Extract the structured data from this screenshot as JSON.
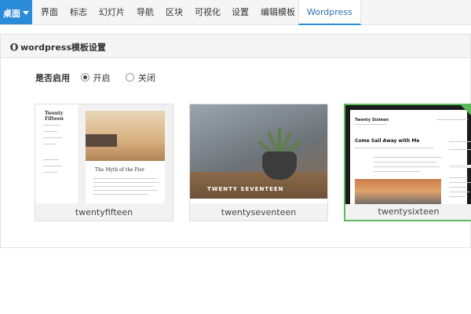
{
  "nav": {
    "desktop_label": "桌面",
    "items": [
      {
        "label": "界面"
      },
      {
        "label": "标志"
      },
      {
        "label": "幻灯片"
      },
      {
        "label": "导航"
      },
      {
        "label": "区块"
      },
      {
        "label": "可视化"
      },
      {
        "label": "设置"
      },
      {
        "label": "编辑模板"
      },
      {
        "label": "Wordpress"
      }
    ],
    "active_index": 8
  },
  "panel": {
    "title": "wordpress模板设置",
    "title_icon": "globe-icon",
    "enable": {
      "label": "是否启用",
      "options": [
        "开启",
        "关闭"
      ],
      "selected": "开启"
    },
    "themes": [
      {
        "name": "twentyfifteen",
        "preview_heading": "The Myth of the Pier",
        "preview_site": "Twenty Fifteen",
        "selected": false
      },
      {
        "name": "twentyseventeen",
        "preview_heading": "TWENTY SEVENTEEN",
        "selected": false
      },
      {
        "name": "twentysixteen",
        "preview_heading": "Come Sail Away with Me",
        "preview_site": "Twenty Sixteen",
        "selected": true
      }
    ]
  },
  "colors": {
    "accent": "#2a8bd8",
    "selected_border": "#5cb85c"
  }
}
